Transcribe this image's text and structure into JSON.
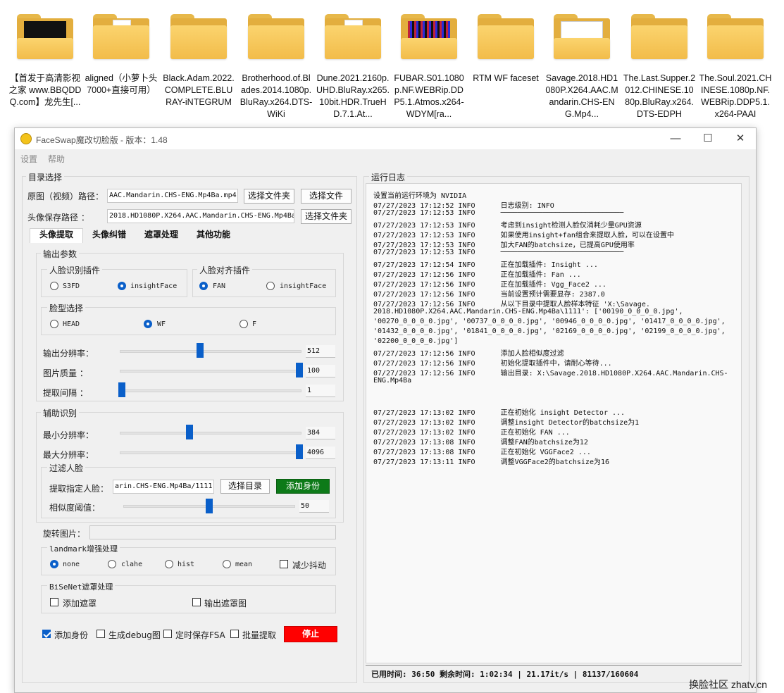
{
  "desktop": {
    "folders": [
      {
        "label": "【首发于高清影视之家 www.BBQDDQ.com】龙先生[..."
      },
      {
        "label": "aligned（小萝卜头7000+直接可用）"
      },
      {
        "label": "Black.Adam.2022.COMPLETE.BLURAY-iNTEGRUM"
      },
      {
        "label": "Brotherhood.of.Blades.2014.1080p.BluRay.x264.DTS-WiKi"
      },
      {
        "label": "Dune.2021.2160p.UHD.BluRay.x265.10bit.HDR.TrueHD.7.1.At..."
      },
      {
        "label": "FUBAR.S01.1080p.NF.WEBRip.DDP5.1.Atmos.x264-WDYM[ra..."
      },
      {
        "label": "RTM WF faceset"
      },
      {
        "label": "Savage.2018.HD1080P.X264.AAC.Mandarin.CHS-ENG.Mp4..."
      },
      {
        "label": "The.Last.Supper.2012.CHINESE.1080p.BluRay.x264.DTS-EDPH"
      },
      {
        "label": "The.Soul.2021.CHINESE.1080p.NF.WEBRip.DDP5.1.x264-PAAI"
      }
    ]
  },
  "window": {
    "title": "FaceSwap魔改切脸版 - 版本：1.48",
    "controls": {
      "minimize": "—",
      "maximize": "☐",
      "close": "✕"
    },
    "menu": [
      "设置",
      "帮助"
    ]
  },
  "dir": {
    "group_title": "目录选择",
    "source_label": "原图（视频）路径：",
    "source_value": "AAC.Mandarin.CHS-ENG.Mp4Ba.mp4",
    "select_folder": "选择文件夹",
    "select_file": "选择文件",
    "save_label": "头像保存路径    ：",
    "save_value": "2018.HD1080P.X264.AAC.Mandarin.CHS-ENG.Mp4Ba",
    "select_folder2": "选择文件夹"
  },
  "tabs": [
    "头像提取",
    "头像纠错",
    "遮罩处理",
    "其他功能"
  ],
  "output": {
    "group_title": "输出参数",
    "detector": {
      "title": "人脸识别插件",
      "options": [
        "S3FD",
        "insightFace"
      ],
      "selected": "insightFace"
    },
    "aligner": {
      "title": "人脸对齐插件",
      "options": [
        "FAN",
        "insightFace"
      ],
      "selected": "FAN"
    },
    "face_type": {
      "title": "脸型选择",
      "options": [
        "HEAD",
        "WF",
        "F"
      ],
      "selected": "WF"
    },
    "sliders": [
      {
        "label": "输出分辨率：",
        "value": "512",
        "fraction": 0.44
      },
      {
        "label": "图片质量   ：",
        "value": "100",
        "fraction": 1.0
      },
      {
        "label": "提取间隔   ：",
        "value": "1",
        "fraction": 0.0
      }
    ]
  },
  "assist": {
    "group_title": "辅助识别",
    "sliders": [
      {
        "label": "最小分辨率：",
        "value": "384",
        "fraction": 0.38
      },
      {
        "label": "最大分辨率：",
        "value": "4096",
        "fraction": 1.0
      }
    ],
    "filter": {
      "title": "过滤人脸",
      "extract_label": "提取指定人脸：",
      "extract_value": "arin.CHS-ENG.Mp4Ba/1111",
      "select_dir": "选择目录",
      "add_identity": "添加身份",
      "similarity_label": "相似度阈值：",
      "similarity_value": "50",
      "similarity_fraction": 0.5
    }
  },
  "rotate_label": "旋转图片：",
  "landmark": {
    "title": "landmark增强处理",
    "options": [
      "none",
      "clahe",
      "hist",
      "mean"
    ],
    "selected": "none",
    "reduce_jitter": "减少抖动"
  },
  "bisenet": {
    "title": "BiSeNet遮罩处理",
    "add_mask": "添加遮罩",
    "output_mask": "输出遮罩图"
  },
  "bottom": {
    "add_identity": "添加身份",
    "add_identity_checked": true,
    "debug": "生成debug图",
    "timed_save": "定时保存FSA",
    "batch": "批量提取",
    "stop": "停止"
  },
  "log": {
    "title": "运行日志",
    "lines": [
      "设置当前运行环境为 NVIDIA",
      "07/27/2023 17:12:52 INFO      日志级别: INFO",
      "07/27/2023 17:12:53 INFO      ─────────────────────────────",
      "07/27/2023 17:12:53 INFO      考虑到insight检测人脸仅消耗少量GPU资源",
      "07/27/2023 17:12:53 INFO      如果使用insight+fan组合来提取人脸，可以在设置中",
      "07/27/2023 17:12:53 INFO      加大FAN的batchsize，已提高GPU使用率",
      "07/27/2023 17:12:53 INFO      ─────────────────────────────",
      "07/27/2023 17:12:54 INFO      正在加载插件: Insight ...",
      "07/27/2023 17:12:56 INFO      正在加载插件: Fan ...",
      "07/27/2023 17:12:56 INFO      正在加载插件: Vgg_Face2 ...",
      "07/27/2023 17:12:56 INFO      当前设置预计需要显存: 2387.0",
      "07/27/2023 17:12:56 INFO      从以下目录中提取人脸样本特征 'X:\\Savage.",
      "2018.HD1080P.X264.AAC.Mandarin.CHS-ENG.Mp4Ba\\1111': ['00190_0_0_0_0.jpg',",
      "'00270_0_0_0_0.jpg', '00737_0_0_0_0.jpg', '00946_0_0_0_0.jpg', '01417_0_0_0_0.jpg',",
      "'01432_0_0_0_0.jpg', '01841_0_0_0_0.jpg', '02169_0_0_0_0.jpg', '02199_0_0_0_0.jpg',",
      "'02200_0_0_0_0.jpg']",
      "07/27/2023 17:12:56 INFO      添加人脸相似度过滤",
      "07/27/2023 17:12:56 INFO      初始化提取插件中，请耐心等待...",
      "07/27/2023 17:12:56 INFO      输出目录: X:\\Savage.2018.HD1080P.X264.AAC.Mandarin.CHS-",
      "ENG.Mp4Ba",
      "",
      "",
      "07/27/2023 17:13:02 INFO      正在初始化 insight Detector ...",
      "07/27/2023 17:13:02 INFO      调整insight Detector的batchsize为1",
      "07/27/2023 17:13:02 INFO      正在初始化 FAN ...",
      "07/27/2023 17:13:08 INFO      调整FAN的batchsize为12",
      "07/27/2023 17:13:08 INFO      正在初始化 VGGFace2 ...",
      "07/27/2023 17:13:11 INFO      调整VGGFace2的batchsize为16"
    ],
    "status": "已用时间: 36:50 剩余时间: 1:02:34 | 21.17it/s | 81137/160604"
  },
  "watermark": "换脸社区 zhatv.cn"
}
